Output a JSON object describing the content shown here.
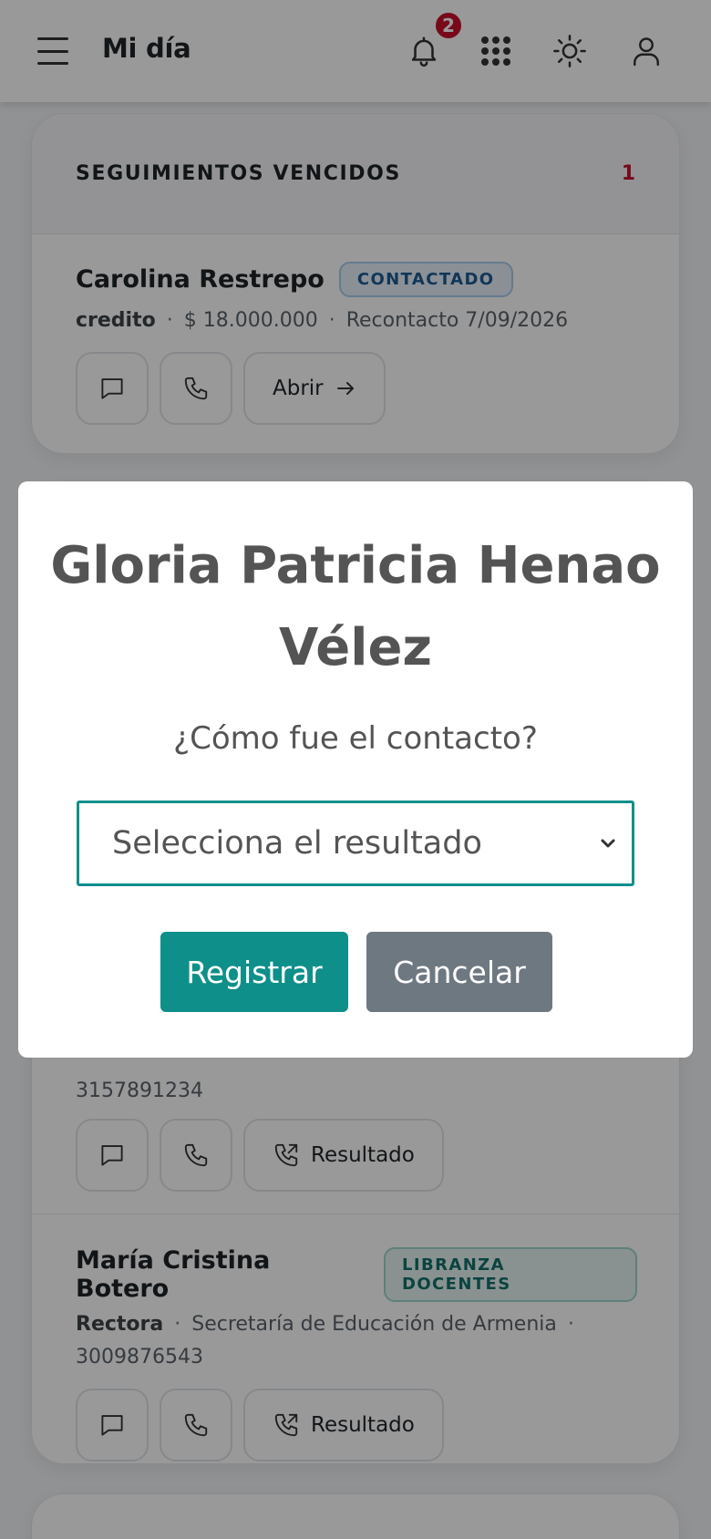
{
  "header": {
    "title": "Mi día",
    "notification_count": "2"
  },
  "overdue_card": {
    "title": "SEGUIMIENTOS VENCIDOS",
    "count": "1",
    "item": {
      "name": "Carolina Restrepo",
      "status": "CONTACTADO",
      "product": "credito",
      "amount": "$ 18.000.000",
      "recontact": "Recontacto 7/09/2026",
      "open_label": "Abrir"
    }
  },
  "contacts_card": {
    "items": [
      {
        "phone": "3157891234",
        "result_label": "Resultado"
      },
      {
        "name": "María Cristina Botero",
        "tag": "LIBRANZA DOCENTES",
        "role": "Rectora",
        "org": "Secretaría de Educación de Armenia",
        "phone": "3009876543",
        "result_label": "Resultado"
      }
    ]
  },
  "modal": {
    "title": "Gloria Patricia Henao Vélez",
    "question": "¿Cómo fue el contacto?",
    "select_placeholder": "Selecciona el resultado",
    "confirm_label": "Registrar",
    "cancel_label": "Cancelar"
  },
  "colors": {
    "accent": "#0f8f8a",
    "danger": "#c8102e",
    "secondary": "#6e7881"
  }
}
